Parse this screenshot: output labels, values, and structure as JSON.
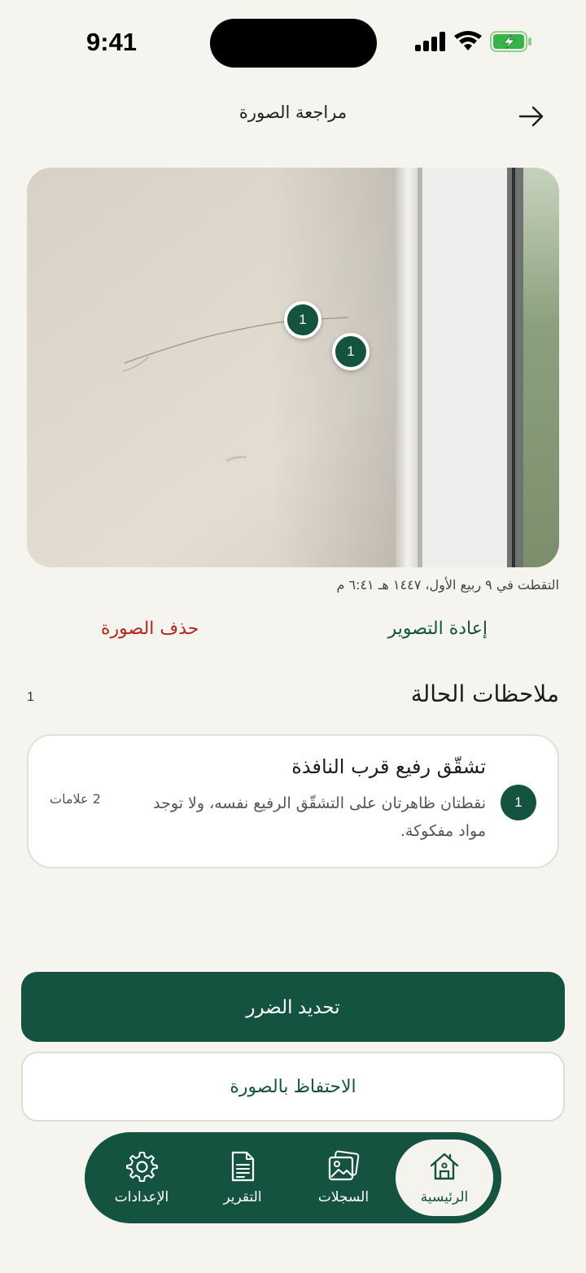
{
  "status_bar": {
    "time": "9:41"
  },
  "header": {
    "title": "مراجعة الصورة"
  },
  "photo": {
    "markers": [
      "1",
      "1"
    ],
    "caption": "التقطت في ٩ ربيع الأول، ١٤٤٧ هـ ٦:٤١ م"
  },
  "actions": {
    "retake_label": "إعادة التصوير",
    "delete_label": "حذف الصورة"
  },
  "notes": {
    "title": "ملاحظات الحالة",
    "count": "1",
    "items": [
      {
        "number": "1",
        "heading": "تشقّق رفيع قرب النافذة",
        "body": "نقطتان ظاهرتان على التشقّق الرفيع نفسه، ولا توجد مواد مفكوكة.",
        "marks": "2 علامات"
      }
    ]
  },
  "buttons": {
    "primary_label": "تحديد الضرر",
    "secondary_label": "الاحتفاظ بالصورة"
  },
  "tabbar": {
    "items": [
      {
        "label": "الرئيسية",
        "icon": "home-icon",
        "active": true
      },
      {
        "label": "السجلات",
        "icon": "gallery-icon",
        "active": false
      },
      {
        "label": "التقرير",
        "icon": "document-icon",
        "active": false
      },
      {
        "label": "الإعدادات",
        "icon": "gear-icon",
        "active": false
      }
    ]
  },
  "colors": {
    "accent": "#14533f",
    "danger": "#b3261e",
    "background": "#f5f4ef"
  }
}
